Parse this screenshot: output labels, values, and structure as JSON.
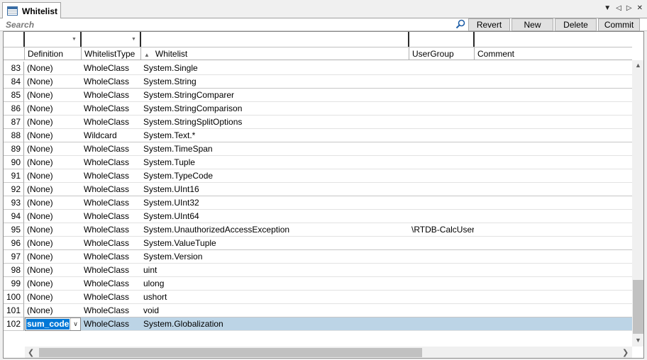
{
  "tab": {
    "title": "Whitelist"
  },
  "search": {
    "placeholder": "Search"
  },
  "buttons": {
    "revert": "Revert",
    "new": "New",
    "delete": "Delete",
    "commit": "Commit"
  },
  "columns": [
    "Definition",
    "WhitelistType",
    "Whitelist",
    "UserGroup",
    "Comment"
  ],
  "rows": [
    {
      "num": "83",
      "definition": "(None)",
      "type": "WholeClass",
      "whitelist": "System.Single",
      "usergroup": "",
      "comment": ""
    },
    {
      "num": "84",
      "definition": "(None)",
      "type": "WholeClass",
      "whitelist": "System.String",
      "usergroup": "",
      "comment": ""
    },
    {
      "num": "85",
      "definition": "(None)",
      "type": "WholeClass",
      "whitelist": "System.StringComparer",
      "usergroup": "",
      "comment": ""
    },
    {
      "num": "86",
      "definition": "(None)",
      "type": "WholeClass",
      "whitelist": "System.StringComparison",
      "usergroup": "",
      "comment": ""
    },
    {
      "num": "87",
      "definition": "(None)",
      "type": "WholeClass",
      "whitelist": "System.StringSplitOptions",
      "usergroup": "",
      "comment": ""
    },
    {
      "num": "88",
      "definition": "(None)",
      "type": "Wildcard",
      "whitelist": "System.Text.*",
      "usergroup": "",
      "comment": ""
    },
    {
      "num": "89",
      "definition": "(None)",
      "type": "WholeClass",
      "whitelist": "System.TimeSpan",
      "usergroup": "",
      "comment": ""
    },
    {
      "num": "90",
      "definition": "(None)",
      "type": "WholeClass",
      "whitelist": "System.Tuple",
      "usergroup": "",
      "comment": ""
    },
    {
      "num": "91",
      "definition": "(None)",
      "type": "WholeClass",
      "whitelist": "System.TypeCode",
      "usergroup": "",
      "comment": ""
    },
    {
      "num": "92",
      "definition": "(None)",
      "type": "WholeClass",
      "whitelist": "System.UInt16",
      "usergroup": "",
      "comment": ""
    },
    {
      "num": "93",
      "definition": "(None)",
      "type": "WholeClass",
      "whitelist": "System.UInt32",
      "usergroup": "",
      "comment": ""
    },
    {
      "num": "94",
      "definition": "(None)",
      "type": "WholeClass",
      "whitelist": "System.UInt64",
      "usergroup": "",
      "comment": ""
    },
    {
      "num": "95",
      "definition": "(None)",
      "type": "WholeClass",
      "whitelist": "System.UnauthorizedAccessException",
      "usergroup": "\\RTDB-CalcUser",
      "comment": ""
    },
    {
      "num": "96",
      "definition": "(None)",
      "type": "WholeClass",
      "whitelist": "System.ValueTuple",
      "usergroup": "",
      "comment": ""
    },
    {
      "num": "97",
      "definition": "(None)",
      "type": "WholeClass",
      "whitelist": "System.Version",
      "usergroup": "",
      "comment": ""
    },
    {
      "num": "98",
      "definition": "(None)",
      "type": "WholeClass",
      "whitelist": "uint",
      "usergroup": "",
      "comment": ""
    },
    {
      "num": "99",
      "definition": "(None)",
      "type": "WholeClass",
      "whitelist": "ulong",
      "usergroup": "",
      "comment": ""
    },
    {
      "num": "100",
      "definition": "(None)",
      "type": "WholeClass",
      "whitelist": "ushort",
      "usergroup": "",
      "comment": ""
    },
    {
      "num": "101",
      "definition": "(None)",
      "type": "WholeClass",
      "whitelist": "void",
      "usergroup": "",
      "comment": ""
    },
    {
      "num": "102",
      "definition": "sum_code",
      "type": "WholeClass",
      "whitelist": "System.Globalization",
      "usergroup": "",
      "comment": ""
    }
  ],
  "selected_row": "102",
  "colors": {
    "selection": "#bcd4e6",
    "edit_highlight": "#0078d7"
  }
}
